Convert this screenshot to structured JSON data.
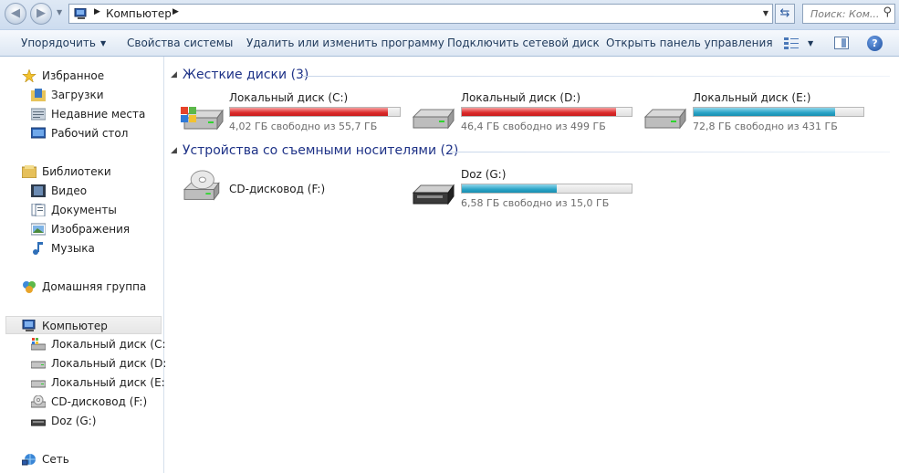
{
  "address": {
    "breadcrumb": "Компьютер",
    "search_placeholder": "Поиск: Ком..."
  },
  "toolbar": {
    "organize": "Упорядочить",
    "system_properties": "Свойства системы",
    "uninstall": "Удалить или изменить программу",
    "map_drive": "Подключить сетевой диск",
    "control_panel": "Открыть панель управления"
  },
  "sidebar": {
    "favorites": "Избранное",
    "downloads": "Загрузки",
    "recent": "Недавние места",
    "desktop": "Рабочий стол",
    "libraries": "Библиотеки",
    "video": "Видео",
    "documents": "Документы",
    "images": "Изображения",
    "music": "Музыка",
    "homegroup": "Домашняя группа",
    "computer": "Компьютер",
    "drive_c": "Локальный диск (C:)",
    "drive_d": "Локальный диск (D:)",
    "drive_e": "Локальный диск (E:)",
    "drive_f": "CD-дисковод (F:)",
    "drive_g": "Doz (G:)",
    "network": "Сеть"
  },
  "groups": {
    "hard_disks": "Жесткие диски (3)",
    "removable": "Устройства со съемными носителями (2)"
  },
  "drives": [
    {
      "name": "Локальный диск (C:)",
      "free": "4,02 ГБ свободно из 55,7 ГБ",
      "used_fraction": 0.928,
      "status": "red"
    },
    {
      "name": "Локальный диск (D:)",
      "free": "46,4 ГБ свободно из 499 ГБ",
      "used_fraction": 0.907,
      "status": "red"
    },
    {
      "name": "Локальный диск (E:)",
      "free": "72,8 ГБ свободно из 431 ГБ",
      "used_fraction": 0.831,
      "status": "blue"
    },
    {
      "name": "CD-дисковод (F:)"
    },
    {
      "name": "Doz (G:)",
      "free": "6,58 ГБ свободно из 15,0 ГБ",
      "used_fraction": 0.561,
      "status": "blue"
    }
  ]
}
